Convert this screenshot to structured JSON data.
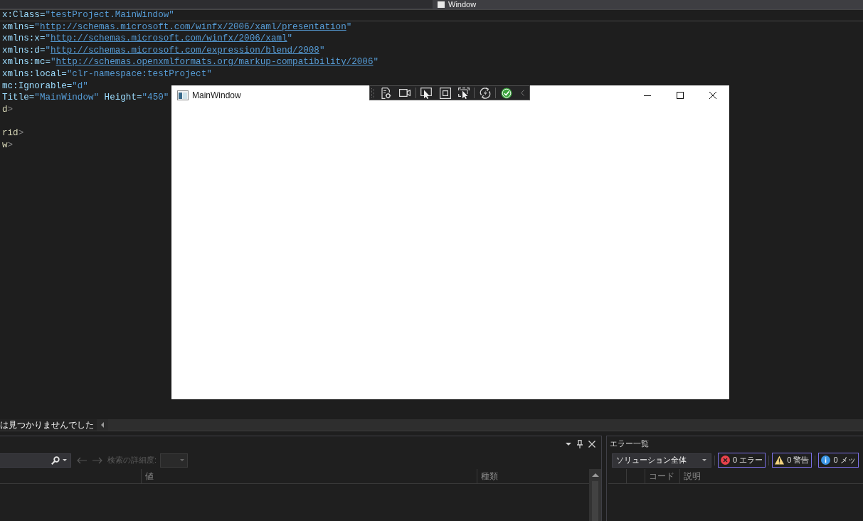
{
  "document_tab": {
    "label": "Window"
  },
  "editor": {
    "lines": [
      {
        "current": true,
        "tokens": [
          {
            "kind": "attr",
            "text": "x:Class="
          },
          {
            "kind": "value",
            "text": "\"testProject.MainWindow\""
          }
        ]
      },
      {
        "current": false,
        "tokens": [
          {
            "kind": "attr",
            "text": "xmlns="
          },
          {
            "kind": "value",
            "text": "\""
          },
          {
            "kind": "link",
            "text": "http://schemas.microsoft.com/winfx/2006/xaml/presentation"
          },
          {
            "kind": "value",
            "text": "\""
          }
        ]
      },
      {
        "current": false,
        "tokens": [
          {
            "kind": "attr",
            "text": "xmlns:x="
          },
          {
            "kind": "value",
            "text": "\""
          },
          {
            "kind": "link",
            "text": "http://schemas.microsoft.com/winfx/2006/xaml"
          },
          {
            "kind": "value",
            "text": "\""
          }
        ]
      },
      {
        "current": false,
        "tokens": [
          {
            "kind": "attr",
            "text": "xmlns:d="
          },
          {
            "kind": "value",
            "text": "\""
          },
          {
            "kind": "link",
            "text": "http://schemas.microsoft.com/expression/blend/2008"
          },
          {
            "kind": "value",
            "text": "\""
          }
        ]
      },
      {
        "current": false,
        "tokens": [
          {
            "kind": "attr",
            "text": "xmlns:mc="
          },
          {
            "kind": "value",
            "text": "\""
          },
          {
            "kind": "link",
            "text": "http://schemas.openxmlformats.org/markup-compatibility/2006"
          },
          {
            "kind": "value",
            "text": "\""
          }
        ]
      },
      {
        "current": false,
        "tokens": [
          {
            "kind": "attr",
            "text": "xmlns:local="
          },
          {
            "kind": "value",
            "text": "\"clr-namespace:testProject\""
          }
        ]
      },
      {
        "current": false,
        "tokens": [
          {
            "kind": "attr",
            "text": "mc:Ignorable="
          },
          {
            "kind": "value",
            "text": "\"d\""
          }
        ]
      },
      {
        "current": false,
        "tokens": [
          {
            "kind": "attr",
            "text": "Title="
          },
          {
            "kind": "value",
            "text": "\"MainWindow\""
          },
          {
            "kind": "attr",
            "text": " Height="
          },
          {
            "kind": "value",
            "text": "\"450\""
          }
        ]
      },
      {
        "current": false,
        "tokens": [
          {
            "kind": "tag",
            "text": "d"
          },
          {
            "kind": "bracket",
            "text": ">"
          }
        ]
      },
      {
        "current": false
      },
      {
        "current": false,
        "tokens": [
          {
            "kind": "tag",
            "text": "rid"
          },
          {
            "kind": "bracket",
            "text": ">"
          }
        ]
      },
      {
        "current": false,
        "tokens": [
          {
            "kind": "tag",
            "text": "w"
          },
          {
            "kind": "bracket",
            "text": ">"
          }
        ]
      }
    ]
  },
  "preview_window": {
    "title": "MainWindow"
  },
  "status_bar": {
    "message": "は見つかりませんでした"
  },
  "properties_panel": {
    "navigation": [
      {
        "kind": "back",
        "disabled": true
      },
      {
        "kind": "forward",
        "disabled": true
      }
    ],
    "search_depth": {
      "label": "検索の詳細度:",
      "disabled": true
    },
    "columns": [
      "値",
      "種類"
    ]
  },
  "error_list": {
    "title": "エラー一覧",
    "scope": "ソリューション全体",
    "filters": [
      {
        "kind": "error",
        "label": "0 エラー",
        "selected": true
      },
      {
        "kind": "warning",
        "label": "0 警告",
        "selected": true
      },
      {
        "kind": "message",
        "label": "0 メッ",
        "selected": true
      }
    ],
    "columns": [
      "コード",
      "説明"
    ]
  }
}
